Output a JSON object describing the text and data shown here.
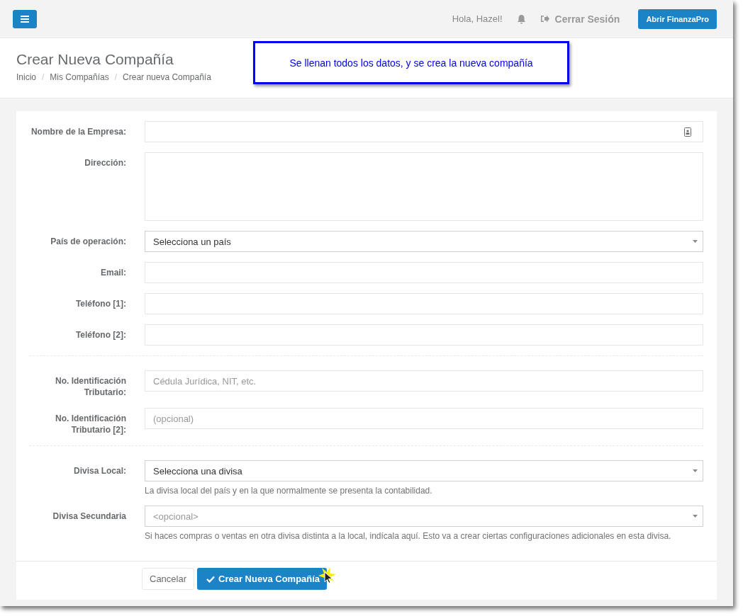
{
  "topbar": {
    "greeting": "Hola, Hazel!",
    "logout": "Cerrar Sesión",
    "open_button": "Abrir FinanzaPro"
  },
  "header": {
    "title": "Crear Nueva Compañía",
    "separator": "/",
    "breadcrumb": [
      {
        "label": "Inicio"
      },
      {
        "label": "Mis Compañías"
      },
      {
        "label": "Crear nueva Compañía"
      }
    ]
  },
  "callout": {
    "text": "Se llenan todos los datos, y se crea la nueva compañía"
  },
  "form": {
    "sections": [
      {
        "fields": [
          {
            "kind": "contact",
            "label": "Nombre de la Empresa:"
          },
          {
            "kind": "textarea",
            "label": "Dirección:"
          },
          {
            "kind": "select",
            "label": "País de operación:",
            "value": "Selecciona un país"
          },
          {
            "kind": "text",
            "label": "Email:"
          },
          {
            "kind": "text",
            "label": "Teléfono [1]:"
          },
          {
            "kind": "text",
            "label": "Teléfono [2]:"
          }
        ]
      },
      {
        "fields": [
          {
            "kind": "text",
            "label": "No. Identificación Tributario:",
            "placeholder": "Cédula Jurídica, NIT, etc."
          },
          {
            "kind": "text",
            "label": "No. Identificación Tributario [2]:",
            "placeholder": "(opcional)"
          }
        ]
      },
      {
        "fields": [
          {
            "kind": "select",
            "label": "Divisa Local:",
            "value": "Selecciona una divisa",
            "help": "La divisa local del país y en la que normalmente se presenta la contabilidad."
          },
          {
            "kind": "select",
            "label": "Divisa Secundaria",
            "placeholder": "<opcional>",
            "help": "Si haces compras o ventas en otra divisa distinta a la local, indícala aquí. Esto va a crear ciertas configuraciones adicionales en esta divisa."
          }
        ]
      }
    ],
    "buttons": [
      {
        "kind": "cancel",
        "label": "Cancelar"
      },
      {
        "kind": "submit",
        "label": "Crear Nueva Compañía"
      }
    ]
  }
}
